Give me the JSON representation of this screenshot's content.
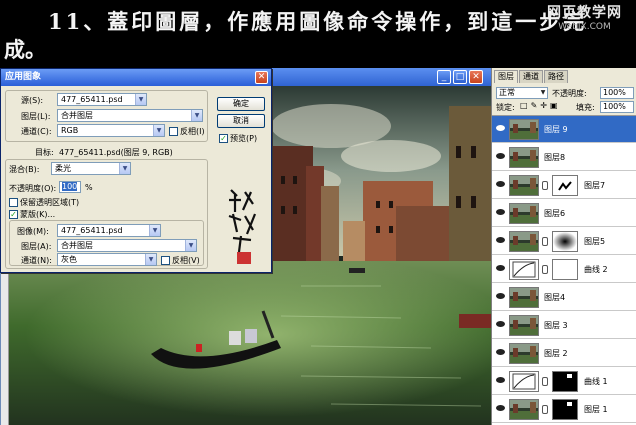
{
  "banner": {
    "line1": "11、蓋印圖層，作應用圖像命令操作，到這一步完",
    "line2": "成。",
    "watermark_title": "网页教学网",
    "watermark_url": "WebJX.COM"
  },
  "dialog": {
    "title": "应用图象",
    "source_label": "源(S):",
    "source_value": "477_65411.psd",
    "layer_label": "图层(L):",
    "layer_value": "合并图层",
    "channel_label": "通道(C):",
    "channel_value": "RGB",
    "invert1_label": "反相(I)",
    "target_label": "目标:",
    "target_value": "477_65411.psd(图层 9, RGB)",
    "blending_label": "混合(B):",
    "blending_value": "柔光",
    "opacity_label": "不透明度(O):",
    "opacity_value": "100",
    "opacity_unit": "%",
    "preserve_label": "保留透明区域(T)",
    "mask_label": "蒙版(K)...",
    "image_label": "图像(M):",
    "image_value": "477_65411.psd",
    "layer2_label": "图层(A):",
    "layer2_value": "合并图层",
    "channel2_label": "通道(N):",
    "channel2_value": "灰色",
    "invert2_label": "反相(V)",
    "ok_label": "确定",
    "cancel_label": "取消",
    "preview_label": "预览(P)",
    "checks": {
      "invert1": false,
      "preserve": false,
      "mask": true,
      "invert2": false,
      "preview": true
    }
  },
  "panel": {
    "tabs": [
      "图层",
      "通道",
      "路径"
    ],
    "blend_mode": "正常",
    "opacity_label": "不透明度:",
    "opacity_value": "100%",
    "lock_label": "锁定:",
    "fill_label": "填充:",
    "fill_value": "100%",
    "layers": [
      {
        "name": "图层 9",
        "type": "photo",
        "selected": true
      },
      {
        "name": "图层8",
        "type": "photo",
        "selected": false
      },
      {
        "name": "图层7",
        "type": "photo-mask",
        "selected": false
      },
      {
        "name": "图层6",
        "type": "photo",
        "selected": false
      },
      {
        "name": "图层5",
        "type": "photo-mask-radial",
        "selected": false
      },
      {
        "name": "曲线 2",
        "type": "adjust-mask-white",
        "selected": false
      },
      {
        "name": "图层4",
        "type": "photo",
        "selected": false
      },
      {
        "name": "图层 3",
        "type": "photo",
        "selected": false
      },
      {
        "name": "图层 2",
        "type": "photo",
        "selected": false
      },
      {
        "name": "曲线 1",
        "type": "adjust-mask-black",
        "selected": false
      },
      {
        "name": "图层 1",
        "type": "photo-mask-black",
        "selected": false
      }
    ]
  }
}
